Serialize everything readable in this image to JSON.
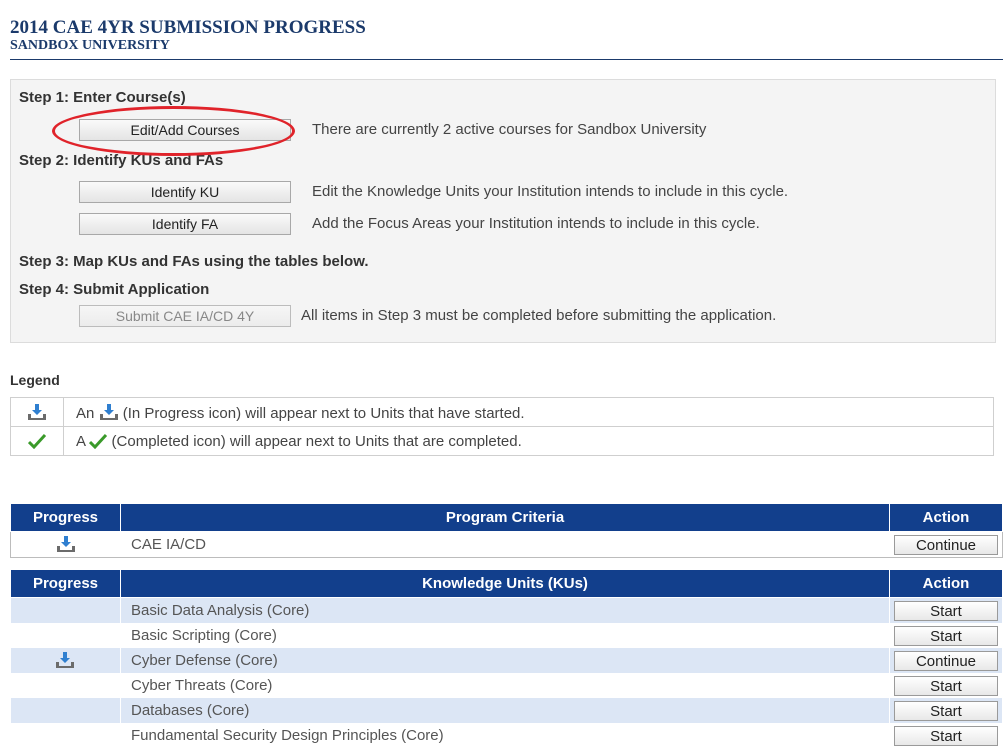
{
  "header": {
    "title": "2014 CAE 4YR SUBMISSION PROGRESS",
    "subtitle": "SANDBOX UNIVERSITY"
  },
  "steps": {
    "step1": {
      "heading": "Step 1: Enter Course(s)",
      "button": "Edit/Add Courses",
      "description": "There are currently 2 active courses for Sandbox University"
    },
    "step2": {
      "heading": "Step 2: Identify KUs and FAs",
      "ku_button": "Identify KU",
      "ku_description": "Edit the Knowledge Units your Institution intends to include in this cycle.",
      "fa_button": "Identify FA",
      "fa_description": "Add the Focus Areas your Institution intends to include in this cycle."
    },
    "step3": {
      "heading": "Step 3: Map KUs and FAs using the tables below."
    },
    "step4": {
      "heading": "Step 4: Submit Application",
      "button": "Submit CAE IA/CD 4Y",
      "description": "All items in Step 3 must be completed before submitting the application."
    }
  },
  "legend": {
    "title": "Legend",
    "in_progress_prefix": "An",
    "in_progress_text": "(In Progress icon) will appear next to Units that have started.",
    "completed_prefix": "A",
    "completed_text": "(Completed icon) will appear next to Units that are completed.",
    "icons": {
      "in_progress": "download-tray-icon",
      "completed": "checkmark-icon"
    }
  },
  "program_table": {
    "headers": {
      "progress": "Progress",
      "criteria": "Program Criteria",
      "action": "Action"
    },
    "rows": [
      {
        "progress_icon": "download-tray-icon",
        "name": "CAE IA/CD",
        "action": "Continue"
      }
    ]
  },
  "ku_table": {
    "headers": {
      "progress": "Progress",
      "criteria": "Knowledge Units (KUs)",
      "action": "Action"
    },
    "rows": [
      {
        "progress_icon": "",
        "name": "Basic Data Analysis (Core)",
        "action": "Start"
      },
      {
        "progress_icon": "",
        "name": "Basic Scripting (Core)",
        "action": "Start"
      },
      {
        "progress_icon": "download-tray-icon",
        "name": "Cyber Defense (Core)",
        "action": "Continue"
      },
      {
        "progress_icon": "",
        "name": "Cyber Threats (Core)",
        "action": "Start"
      },
      {
        "progress_icon": "",
        "name": "Databases (Core)",
        "action": "Start"
      },
      {
        "progress_icon": "",
        "name": "Fundamental Security Design Principles (Core)",
        "action": "Start"
      }
    ]
  },
  "colors": {
    "title": "#1b3a6b",
    "table_header": "#123f8c",
    "row_alt": "#dce6f5",
    "annotation_circle": "#e0232a",
    "icon_blue": "#2f7fd0",
    "check_green": "#3a9a2a"
  }
}
